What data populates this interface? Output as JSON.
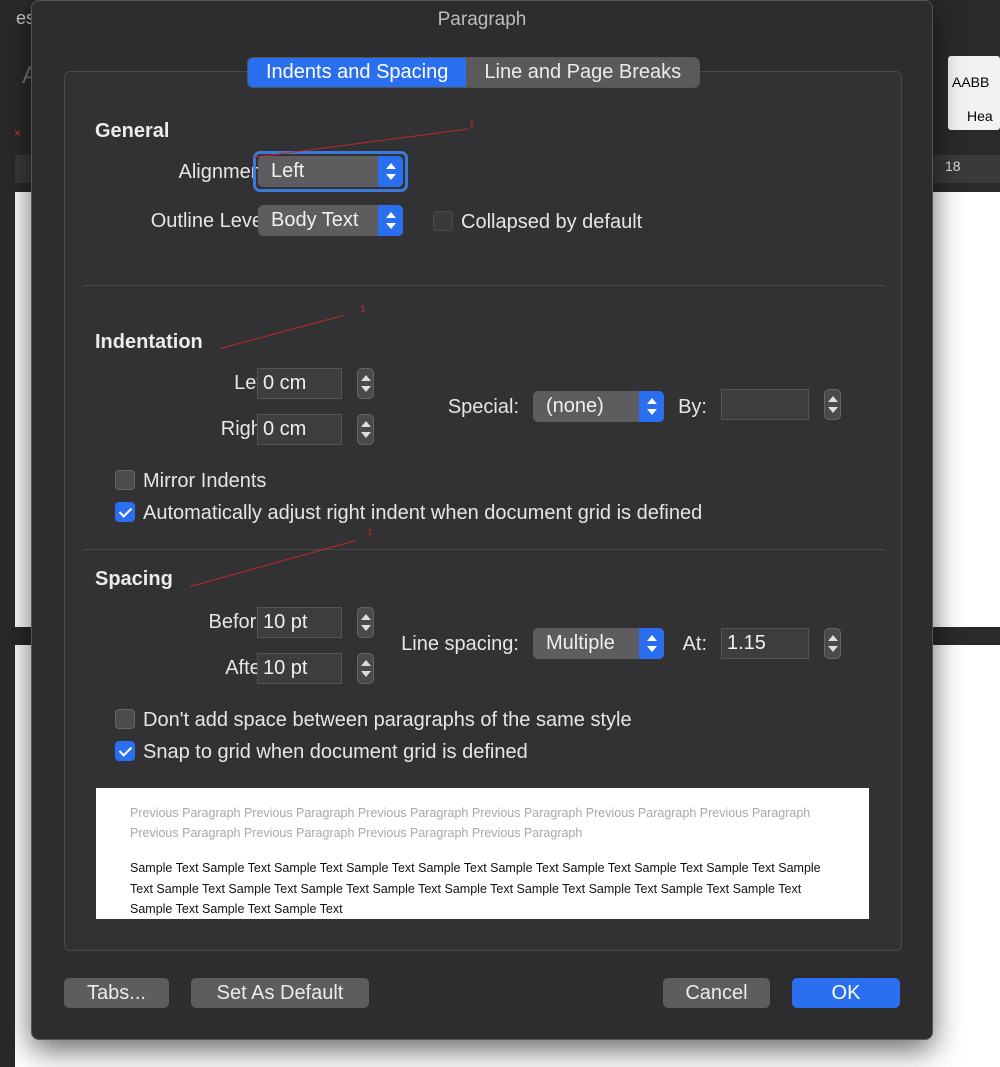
{
  "background": {
    "title_fragment": "es",
    "left_fragment": "A",
    "ruler_number": "18",
    "style_thumb_text": "AABB",
    "style_thumb_label": "Hea"
  },
  "dialog": {
    "title": "Paragraph",
    "tabs": [
      {
        "label": "Indents and Spacing",
        "active": true
      },
      {
        "label": "Line and Page Breaks",
        "active": false
      }
    ]
  },
  "general": {
    "title": "General",
    "alignment_label": "Alignment:",
    "alignment_value": "Left",
    "outline_label": "Outline Level:",
    "outline_value": "Body Text",
    "collapsed_label": "Collapsed by default"
  },
  "indentation": {
    "title": "Indentation",
    "left_label": "Left:",
    "left_value": "0 cm",
    "right_label": "Right:",
    "right_value": "0 cm",
    "special_label": "Special:",
    "special_value": "(none)",
    "by_label": "By:",
    "by_value": "",
    "mirror_label": "Mirror Indents",
    "auto_adjust_label": "Automatically adjust right indent when document grid is defined"
  },
  "spacing": {
    "title": "Spacing",
    "before_label": "Before:",
    "before_value": "10 pt",
    "after_label": "After:",
    "after_value": "10 pt",
    "line_spacing_label": "Line spacing:",
    "line_spacing_value": "Multiple",
    "at_label": "At:",
    "at_value": "1.15",
    "dont_add_label": "Don't add space between paragraphs of the same style",
    "snap_label": "Snap to grid when document grid is defined"
  },
  "preview": {
    "previous_text": "Previous Paragraph Previous Paragraph Previous Paragraph Previous Paragraph Previous Paragraph Previous Paragraph Previous Paragraph Previous Paragraph Previous Paragraph Previous Paragraph",
    "sample_text": "Sample Text Sample Text Sample Text Sample Text Sample Text Sample Text Sample Text Sample Text Sample Text Sample Text Sample Text Sample Text Sample Text Sample Text Sample Text Sample Text Sample Text Sample Text Sample Text Sample Text Sample Text Sample Text"
  },
  "buttons": {
    "tabs": "Tabs...",
    "set_default": "Set As Default",
    "cancel": "Cancel",
    "ok": "OK"
  },
  "annotations": {
    "marker": "1"
  },
  "colors": {
    "accent": "#2a6ff0",
    "dialog_bg": "#2d2c2e",
    "annotation": "#c0282c"
  }
}
